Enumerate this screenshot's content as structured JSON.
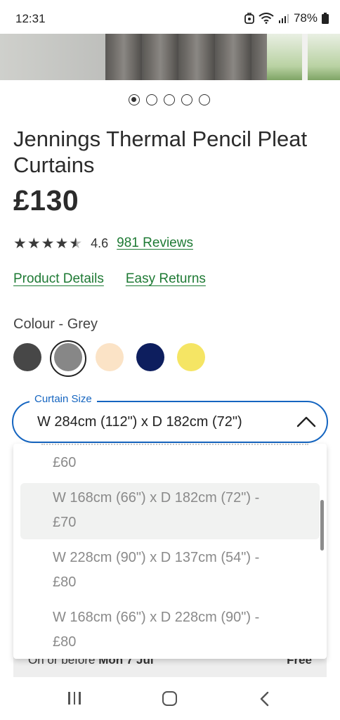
{
  "status_bar": {
    "time": "12:31",
    "battery": "78%",
    "icons": [
      "data-saver-icon",
      "wifi-icon",
      "signal-icon",
      "battery-icon"
    ]
  },
  "gallery": {
    "image_alt": "grey curtains",
    "dots_total": 5,
    "active_index": 0
  },
  "product": {
    "title": "Jennings Thermal Pencil Pleat Curtains",
    "price": "£130",
    "rating": "4.6",
    "rating_stars": 4.6,
    "reviews_link": "981 Reviews"
  },
  "tabs": {
    "product_details": "Product Details",
    "easy_returns": "Easy Returns"
  },
  "colour": {
    "label": "Colour - Grey",
    "swatches": [
      {
        "name": "charcoal",
        "hex": "#474747"
      },
      {
        "name": "grey",
        "hex": "#878787",
        "selected": true
      },
      {
        "name": "cream",
        "hex": "#fbe3c6"
      },
      {
        "name": "navy",
        "hex": "#0d1e5e"
      },
      {
        "name": "yellow",
        "hex": "#f5e564"
      }
    ]
  },
  "size_select": {
    "label": "Curtain Size",
    "value": "W 284cm (112\") x D 182cm (72\")",
    "accent": "#1565c0",
    "options": [
      {
        "line1": "£60"
      },
      {
        "line1": "W 168cm (66\") x D 182cm (72\") -",
        "line2": "£70",
        "highlighted": true
      },
      {
        "line1": "W 228cm (90\") x D 137cm (54\") -",
        "line2": "£80"
      },
      {
        "line1": "W 168cm (66\") x D 228cm (90\") -",
        "line2": "£80"
      }
    ]
  },
  "delivery": {
    "prefix": "On or before",
    "date": "Mon 7 Jul",
    "cost": "Free"
  },
  "nav": {
    "icons": [
      "recents-icon",
      "home-icon",
      "back-icon"
    ]
  }
}
